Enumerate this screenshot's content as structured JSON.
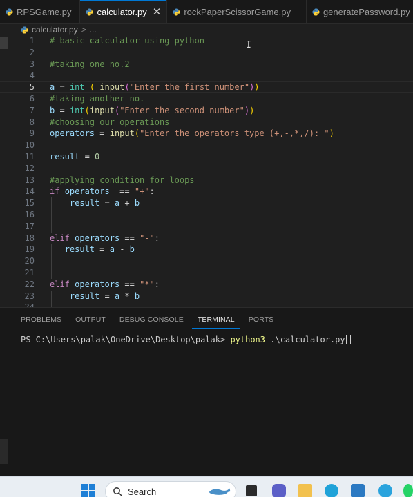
{
  "tabs": [
    {
      "label": "RPSGame.py",
      "active": false
    },
    {
      "label": "calculator.py",
      "active": true,
      "close": "✕"
    },
    {
      "label": "rockPaperScissorGame.py",
      "active": false
    },
    {
      "label": "generatePassword.py",
      "active": false
    }
  ],
  "breadcrumb": {
    "file": "calculator.py",
    "separator": ">",
    "more": "..."
  },
  "editor": {
    "current_line": 5,
    "lines": [
      {
        "n": "1",
        "text": "# basic calculator using python"
      },
      {
        "n": "2",
        "text": ""
      },
      {
        "n": "3",
        "text": "#taking one no.2"
      },
      {
        "n": "4",
        "text": ""
      },
      {
        "n": "5",
        "text": "a = int ( input(\"Enter the first number\"))"
      },
      {
        "n": "6",
        "text": "#taking another no."
      },
      {
        "n": "7",
        "text": "b = int(input(\"Enter the second number\"))"
      },
      {
        "n": "8",
        "text": "#choosing our operations"
      },
      {
        "n": "9",
        "text": "operators = input(\"Enter the operators type (+,-,*,/): \")"
      },
      {
        "n": "10",
        "text": ""
      },
      {
        "n": "11",
        "text": "result = 0"
      },
      {
        "n": "12",
        "text": ""
      },
      {
        "n": "13",
        "text": "#applying condition for loops"
      },
      {
        "n": "14",
        "text": "if operators  == \"+\":"
      },
      {
        "n": "15",
        "text": "    result = a + b"
      },
      {
        "n": "16",
        "text": ""
      },
      {
        "n": "17",
        "text": ""
      },
      {
        "n": "18",
        "text": "elif operators == \"-\":"
      },
      {
        "n": "19",
        "text": "   result = a - b"
      },
      {
        "n": "20",
        "text": ""
      },
      {
        "n": "21",
        "text": ""
      },
      {
        "n": "22",
        "text": "elif operators == \"*\":"
      },
      {
        "n": "23",
        "text": "    result = a * b"
      },
      {
        "n": "24",
        "text": ""
      }
    ]
  },
  "panel": {
    "tabs": [
      "PROBLEMS",
      "OUTPUT",
      "DEBUG CONSOLE",
      "TERMINAL",
      "PORTS"
    ],
    "active_tab": "TERMINAL",
    "prompt": "PS C:\\Users\\palak\\OneDrive\\Desktop\\palak> ",
    "command": "python3",
    "args": " .\\calculator.py"
  },
  "taskbar": {
    "search_label": "Search",
    "icons": [
      "windows-start-icon",
      "search-icon",
      "task-view-icon",
      "teams-icon",
      "file-explorer-icon",
      "edge-icon",
      "app-icon",
      "app-icon",
      "telegram-icon",
      "whatsapp-icon"
    ]
  },
  "colors": {
    "editor_bg": "#1f1f1f",
    "accent": "#0078d4",
    "comment": "#6a9955",
    "string": "#ce9178",
    "keyword": "#c586c0",
    "variable": "#9cdcfe",
    "function": "#dcdcaa",
    "builtin": "#4ec9b0",
    "number": "#b5cea8"
  }
}
